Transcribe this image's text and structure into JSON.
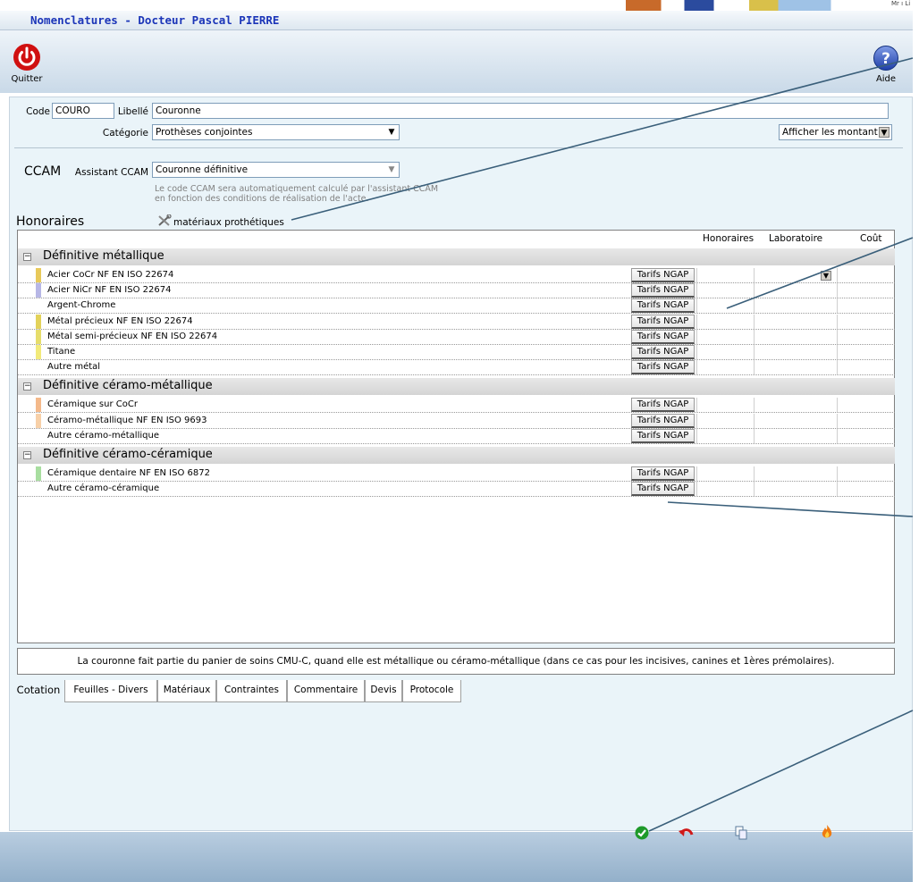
{
  "window": {
    "title": "Nomenclatures - Docteur Pascal PIERRE",
    "corner_text": "Mr ı Li"
  },
  "toolbar": {
    "quit_label": "Quitter",
    "help_label": "Aide"
  },
  "form": {
    "code_label": "Code",
    "code_value": "COURO",
    "libelle_label": "Libellé",
    "libelle_value": "Couronne",
    "categorie_label": "Catégorie",
    "categorie_value": "Prothèses conjointes",
    "amounts_select": "Afficher les montant"
  },
  "ccam": {
    "title": "CCAM",
    "assistant_label": "Assistant CCAM",
    "assistant_value": "Couronne définitive",
    "hint_line1": "Le code CCAM sera automatiquement calculé par l'assistant CCAM",
    "hint_line2": "en fonction des conditions de réalisation de l'acte."
  },
  "honoraires": {
    "title": "Honoraires",
    "materials_link": "matériaux prothétiques"
  },
  "grid": {
    "headers": {
      "honoraires": "Honoraires",
      "laboratoire": "Laboratoire",
      "cout": "Coût"
    },
    "tarif_label": "Tarifs NGAP",
    "toggle_symbol": "−",
    "groups": [
      {
        "title": "Définitive métallique",
        "rows": [
          {
            "name": "Acier CoCr NF EN ISO 22674",
            "color": "#e8c95a"
          },
          {
            "name": "Acier NiCr NF EN ISO 22674",
            "color": "#b7b7e6"
          },
          {
            "name": "Argent-Chrome",
            "color": ""
          },
          {
            "name": "Métal précieux NF EN ISO 22674",
            "color": "#e3d25a"
          },
          {
            "name": "Métal semi-précieux NF EN ISO 22674",
            "color": "#e6dd6b"
          },
          {
            "name": "Titane",
            "color": "#f2ea7a"
          },
          {
            "name": "Autre métal",
            "color": ""
          }
        ]
      },
      {
        "title": "Définitive céramo-métallique",
        "rows": [
          {
            "name": "Céramique sur CoCr",
            "color": "#f4b98a"
          },
          {
            "name": "Céramo-métallique NF EN ISO 9693",
            "color": "#f7d0a8"
          },
          {
            "name": "Autre céramo-métallique",
            "color": ""
          }
        ]
      },
      {
        "title": "Définitive céramo-céramique",
        "rows": [
          {
            "name": "Céramique dentaire NF EN ISO 6872",
            "color": "#a8dea0"
          },
          {
            "name": "Autre céramo-céramique",
            "color": ""
          }
        ]
      }
    ]
  },
  "note": "La couronne fait partie du panier de soins CMU-C, quand elle est métallique ou céramo-métallique (dans ce cas pour les incisives, canines et 1ères prémolaires).",
  "tabs": [
    "Cotation",
    "Feuilles - Divers",
    "Matériaux",
    "Contraintes",
    "Commentaire",
    "Devis",
    "Protocole"
  ],
  "colors": {
    "title_text": "#1b35b8",
    "quit_red": "#d01010",
    "help_blue": "#2c4bb8",
    "annotation": "#3a5f7a"
  }
}
